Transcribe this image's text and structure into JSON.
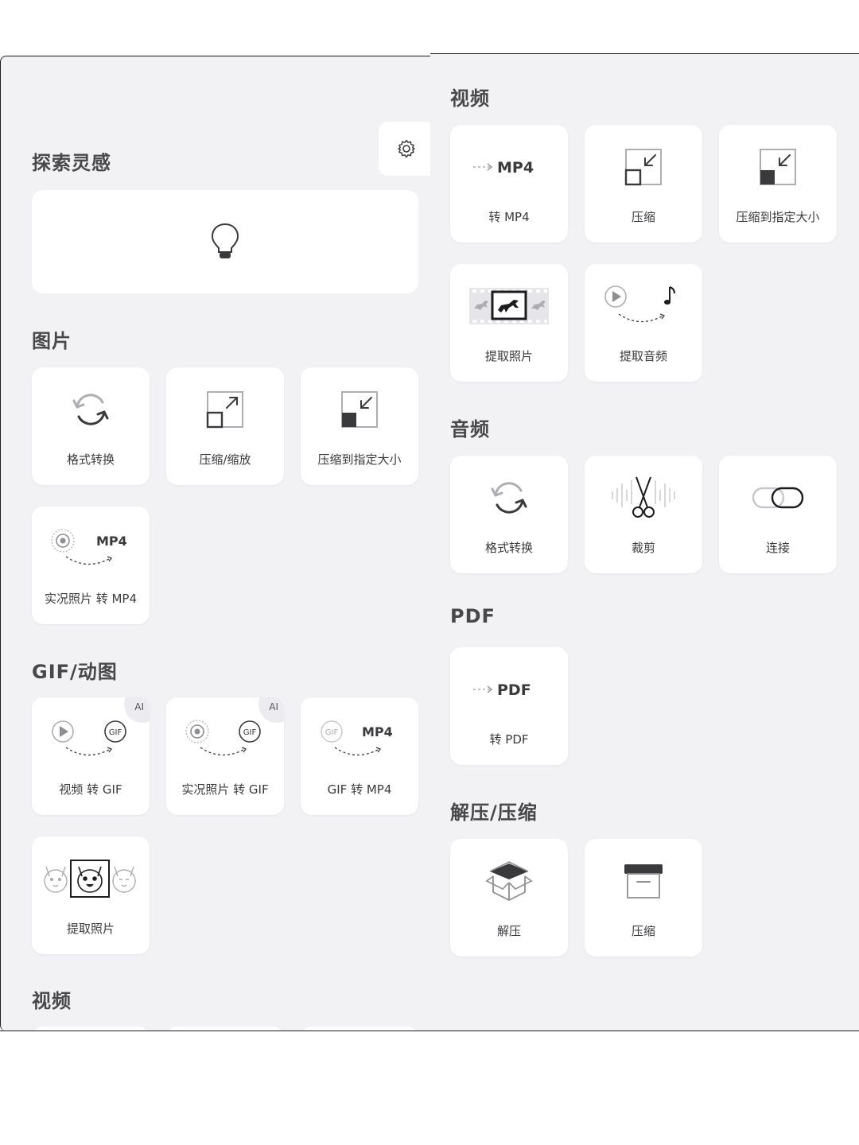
{
  "left": {
    "sections": {
      "inspire": "探索灵感",
      "image": "图片",
      "gif": "GIF/动图",
      "video": "视频"
    },
    "image_tiles": [
      "格式转换",
      "压缩/缩放",
      "压缩到指定大小",
      "实况照片 转 MP4"
    ],
    "gif_tiles": [
      "视频 转 GIF",
      "实况照片 转 GIF",
      "GIF 转 MP4",
      "提取照片"
    ],
    "ai_badge": "AI",
    "icon_text": {
      "mp4": "MP4",
      "gif": "GIF"
    }
  },
  "right": {
    "sections": {
      "video": "视频",
      "audio": "音频",
      "pdf": "PDF",
      "archive": "解压/压缩"
    },
    "video_tiles": [
      "转 MP4",
      "压缩",
      "压缩到指定大小",
      "提取照片",
      "提取音频"
    ],
    "audio_tiles": [
      "格式转换",
      "裁剪",
      "连接"
    ],
    "pdf_tiles": [
      "转 PDF"
    ],
    "archive_tiles": [
      "解压",
      "压缩"
    ],
    "icon_text": {
      "mp4": "MP4",
      "pdf": "PDF"
    }
  },
  "icons": {
    "settings": "gear-icon",
    "inspire": "lightbulb-icon"
  }
}
